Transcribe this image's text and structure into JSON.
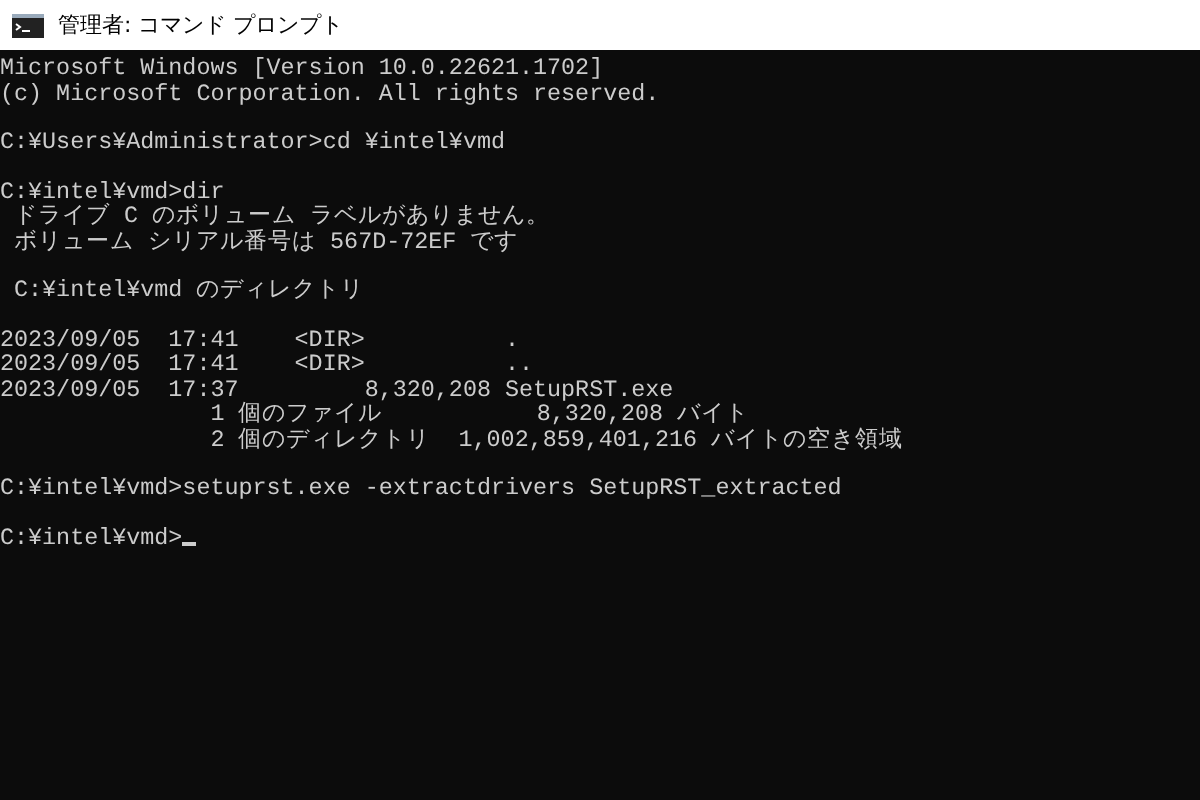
{
  "window": {
    "title": "管理者: コマンド プロンプト"
  },
  "console": {
    "blocks": [
      {
        "lines": [
          "Microsoft Windows [Version 10.0.22621.1702]",
          "(c) Microsoft Corporation. All rights reserved."
        ]
      },
      {
        "lines": [
          "C:¥Users¥Administrator>cd ¥intel¥vmd"
        ]
      },
      {
        "lines": [
          "C:¥intel¥vmd>dir",
          " ドライブ C のボリューム ラベルがありません。",
          " ボリューム シリアル番号は 567D-72EF です"
        ]
      },
      {
        "lines": [
          " C:¥intel¥vmd のディレクトリ"
        ]
      },
      {
        "lines": [
          "2023/09/05  17:41    <DIR>          .",
          "2023/09/05  17:41    <DIR>          ..",
          "2023/09/05  17:37         8,320,208 SetupRST.exe",
          "               1 個のファイル           8,320,208 バイト",
          "               2 個のディレクトリ  1,002,859,401,216 バイトの空き領域"
        ]
      },
      {
        "lines": [
          "C:¥intel¥vmd>setuprst.exe -extractdrivers SetupRST_extracted"
        ]
      }
    ],
    "prompt": {
      "text": "C:¥intel¥vmd>",
      "cursor": true
    }
  }
}
